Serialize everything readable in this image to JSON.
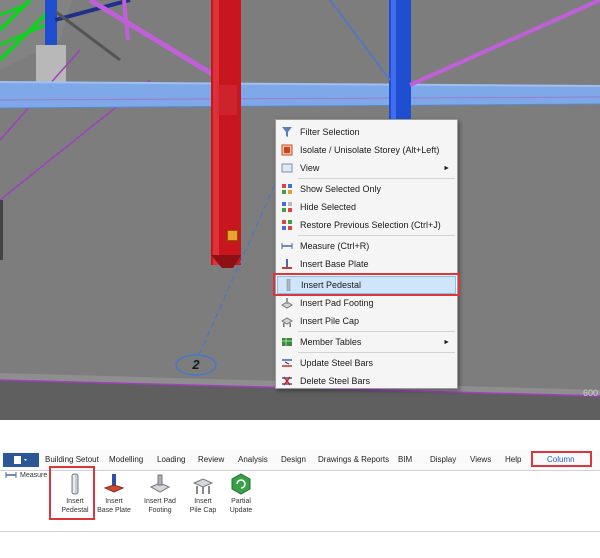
{
  "context_menu": {
    "items": [
      {
        "label": "Filter Selection",
        "icon": "filter-icon",
        "submenu": false
      },
      {
        "label": "Isolate / Unisolate Storey (Alt+Left)",
        "icon": "isolate-icon",
        "submenu": false
      },
      {
        "label": "View",
        "icon": "view-icon",
        "submenu": true
      },
      {
        "label": "Show Selected Only",
        "icon": "show-selected-icon",
        "submenu": false
      },
      {
        "label": "Hide Selected",
        "icon": "hide-selected-icon",
        "submenu": false
      },
      {
        "label": "Restore Previous Selection (Ctrl+J)",
        "icon": "restore-selection-icon",
        "submenu": false
      },
      {
        "label": "Measure (Ctrl+R)",
        "icon": "measure-icon",
        "submenu": false
      },
      {
        "label": "Insert Base Plate",
        "icon": "base-plate-icon",
        "submenu": false
      },
      {
        "label": "Insert Pedestal",
        "icon": "pedestal-icon",
        "submenu": false,
        "highlighted": true
      },
      {
        "label": "Insert Pad Footing",
        "icon": "pad-footing-icon",
        "submenu": false
      },
      {
        "label": "Insert Pile Cap",
        "icon": "pile-cap-icon",
        "submenu": false
      },
      {
        "label": "Member Tables",
        "icon": "member-tables-icon",
        "submenu": true
      },
      {
        "label": "Update Steel Bars",
        "icon": "update-bars-icon",
        "submenu": false
      },
      {
        "label": "Delete Steel Bars",
        "icon": "delete-bars-icon",
        "submenu": false
      }
    ],
    "submenu_arrow": "►"
  },
  "viewport": {
    "grid_label": "2",
    "coord_text": "600"
  },
  "ribbon": {
    "tabs": [
      "Building Setout",
      "Modelling",
      "Loading",
      "Review",
      "Analysis",
      "Design",
      "Drawings & Reports",
      "BIM",
      "Display",
      "Views",
      "Help",
      "Column"
    ],
    "active_tab": "Column",
    "measure_label": "Measure",
    "buttons": [
      {
        "label": "Insert\nPedestal",
        "icon": "pedestal-icon"
      },
      {
        "label": "Insert\nBase Plate",
        "icon": "base-plate-icon"
      },
      {
        "label": "Insert Pad\nFooting",
        "icon": "pad-footing-icon"
      },
      {
        "label": "Insert\nPile Cap",
        "icon": "pile-cap-icon"
      },
      {
        "label": "Partial\nUpdate",
        "icon": "partial-update-icon"
      }
    ]
  },
  "colors": {
    "highlight_box": "#d9363e",
    "column_red": "#c8161e",
    "column_blue": "#1f4fd0",
    "beam_blue": "#7fa8e8",
    "brace_magenta": "#c060d8"
  }
}
